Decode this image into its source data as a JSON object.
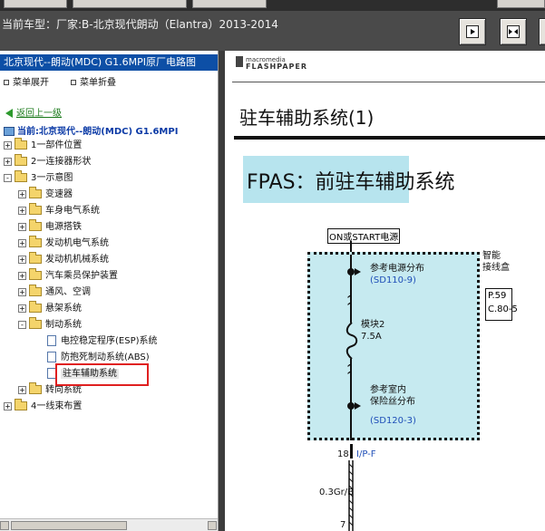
{
  "header": {
    "title": "当前车型：厂家:B-北京现代朗动（Elantra）2013-2014"
  },
  "left_panel": {
    "heading": "北京现代--朗动(MDC) G1.6MPI原厂电路图",
    "menu": {
      "expand": "菜单展开",
      "collapse": "菜单折叠"
    },
    "back_link": "返回上一级",
    "current_label": "当前:北京现代--朗动(MDC) G1.6MPI",
    "tree": [
      {
        "label": "1一部件位置",
        "level": 0,
        "expand": "+"
      },
      {
        "label": "2一连接器形状",
        "level": 0,
        "expand": "+"
      },
      {
        "label": "3一示意图",
        "level": 0,
        "expand": "-"
      },
      {
        "label": "变速器",
        "level": 1,
        "expand": "+"
      },
      {
        "label": "车身电气系统",
        "level": 1,
        "expand": "+"
      },
      {
        "label": "电源搭铁",
        "level": 1,
        "expand": "+"
      },
      {
        "label": "发动机电气系统",
        "level": 1,
        "expand": "+"
      },
      {
        "label": "发动机机械系统",
        "level": 1,
        "expand": "+"
      },
      {
        "label": "汽车乘员保护装置",
        "level": 1,
        "expand": "+"
      },
      {
        "label": "通风、空调",
        "level": 1,
        "expand": "+"
      },
      {
        "label": "悬架系统",
        "level": 1,
        "expand": "+"
      },
      {
        "label": "制动系统",
        "level": 1,
        "expand": "-"
      },
      {
        "label": "电控稳定程序(ESP)系统",
        "level": 2
      },
      {
        "label": "防抱死制动系统(ABS)",
        "level": 2
      },
      {
        "label": "驻车辅助系统",
        "level": 2
      },
      {
        "label": "转向系统",
        "level": 1,
        "expand": "+"
      },
      {
        "label": "4一线束布置",
        "level": 0,
        "expand": "+"
      }
    ]
  },
  "document": {
    "logo_top": "macromedia",
    "logo_bottom": "FLASHPAPER",
    "page_title": "驻车辅助系统(1)",
    "diagram_title": "FPAS：前驻车辅助系统",
    "on_start": "ON或START电源",
    "junction_label": [
      "智能",
      "接线盒"
    ],
    "p_box": [
      "P.59",
      "C.80-5"
    ],
    "ref1_text": [
      "参考电源分布"
    ],
    "ref1_code": "(SD110-9)",
    "fuse": [
      "模块2",
      "7.5A"
    ],
    "ref2_text": [
      "参考室内",
      "保险丝分布"
    ],
    "ref2_code": "(SD120-3)",
    "pin_18": "18",
    "connector": "I/P-F",
    "wire": "0.3Gr/B",
    "pin_7": "7"
  },
  "colors": {
    "accent": "#0d4fa6",
    "highlight_border": "#e02020",
    "diagram_fill": "#c6eaf0",
    "title_fill": "#b7e4ee"
  }
}
